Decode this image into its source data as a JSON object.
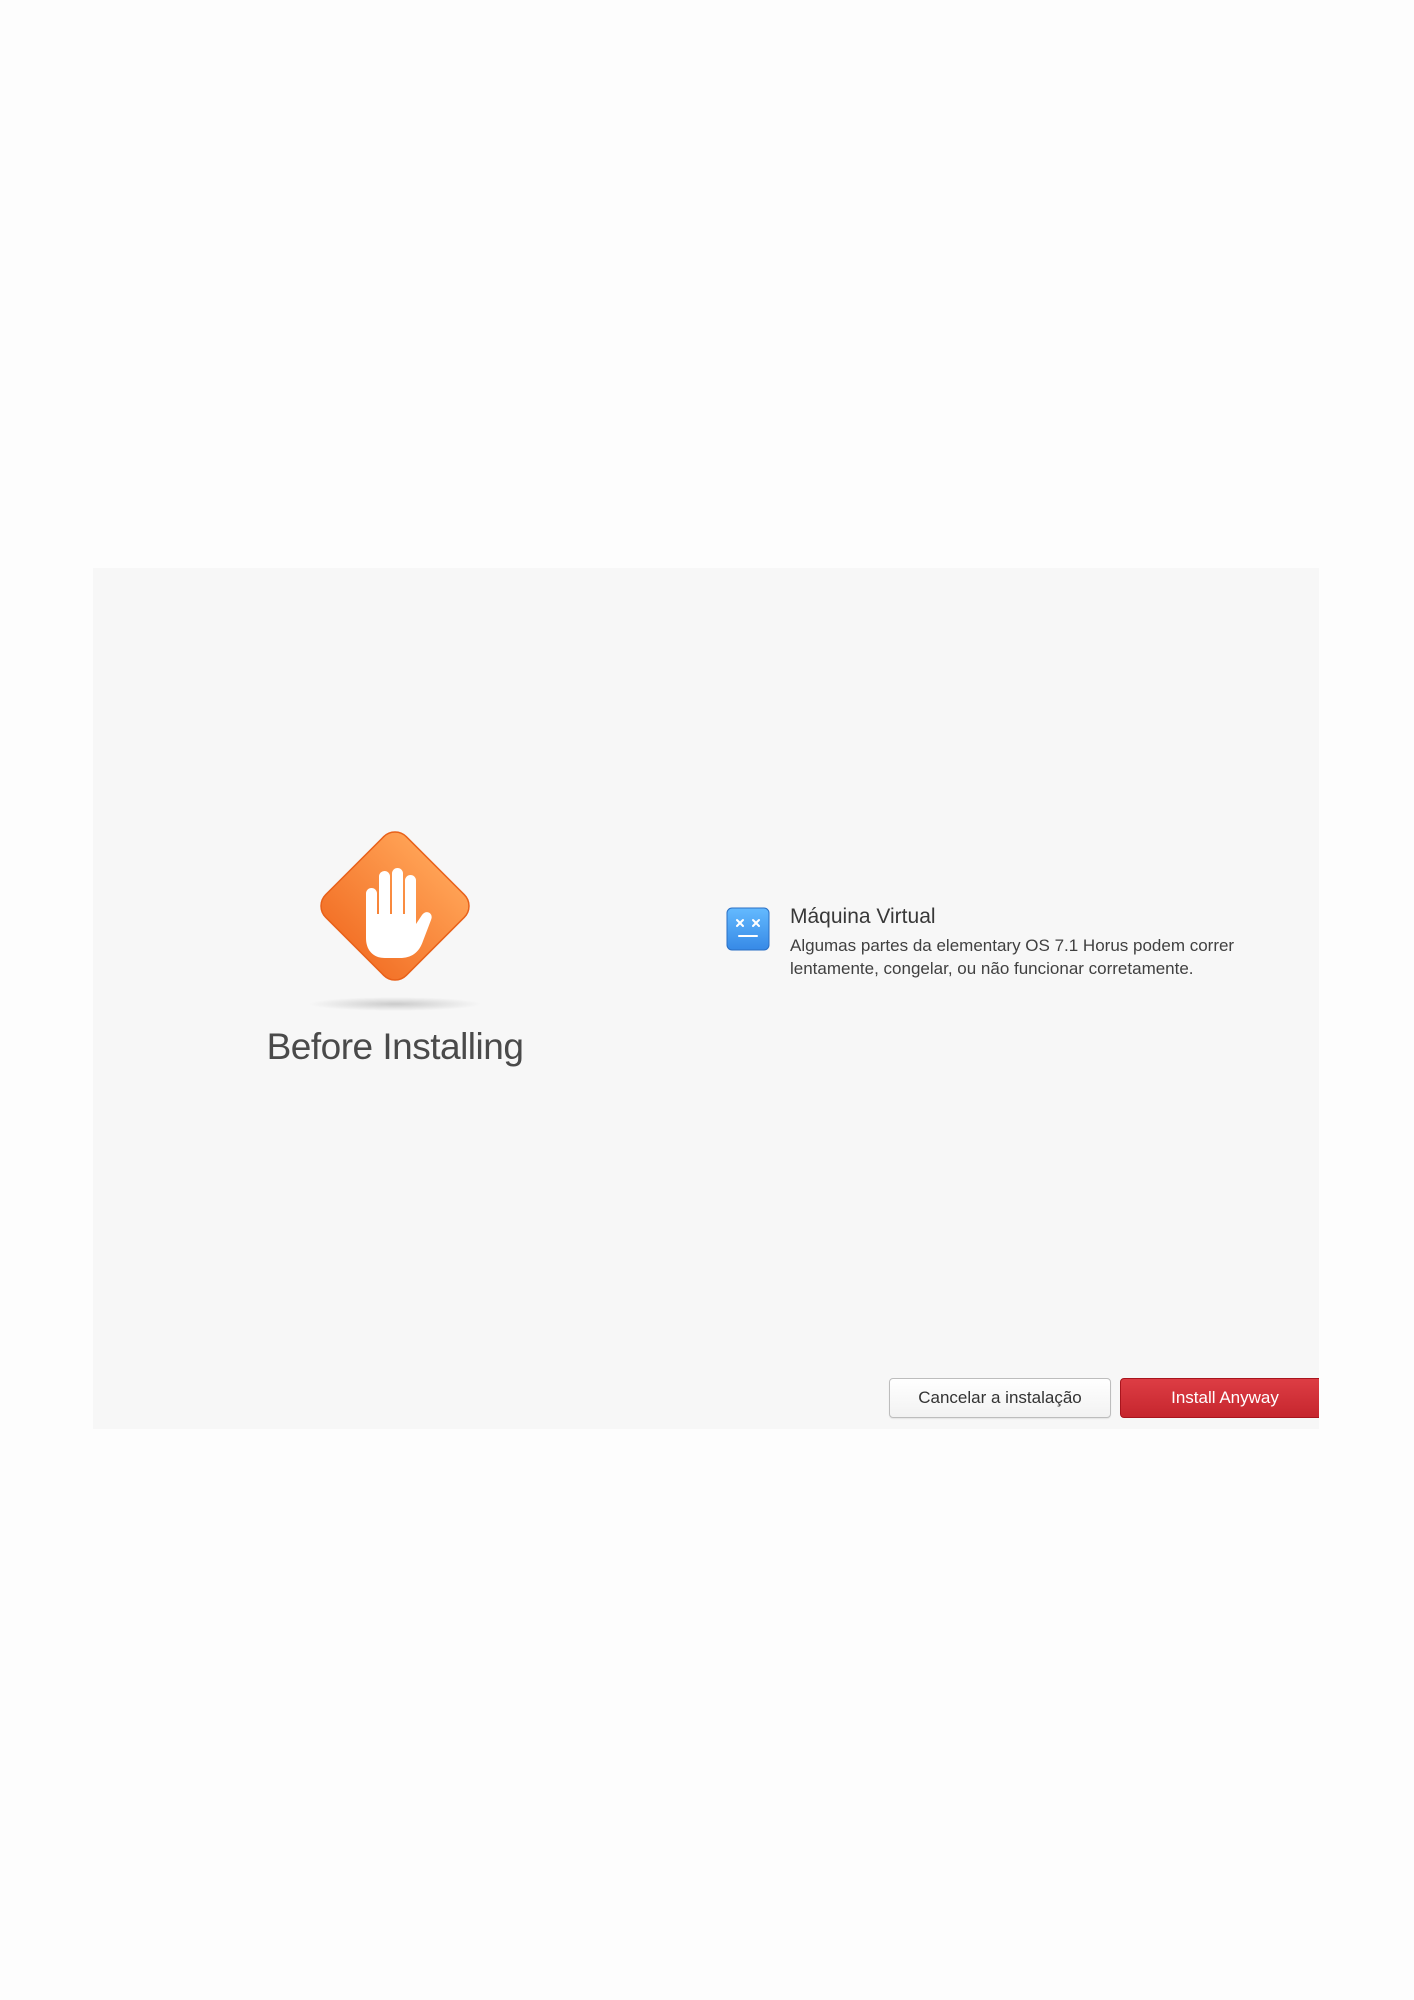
{
  "hero": {
    "icon": "stop-hand-icon",
    "title": "Before Installing"
  },
  "issues": [
    {
      "icon": "virtual-machine-icon",
      "title": "Máquina Virtual",
      "description": "Algumas partes da elementary OS 7.1 Horus podem correr lentamente, congelar, ou não funcionar corretamente."
    }
  ],
  "actions": {
    "cancel_label": "Cancelar a instalação",
    "install_label": "Install Anyway"
  },
  "colors": {
    "warning_orange": "#f37329",
    "destructive_red": "#c6262e",
    "vm_icon_blue": "#3689e6"
  }
}
